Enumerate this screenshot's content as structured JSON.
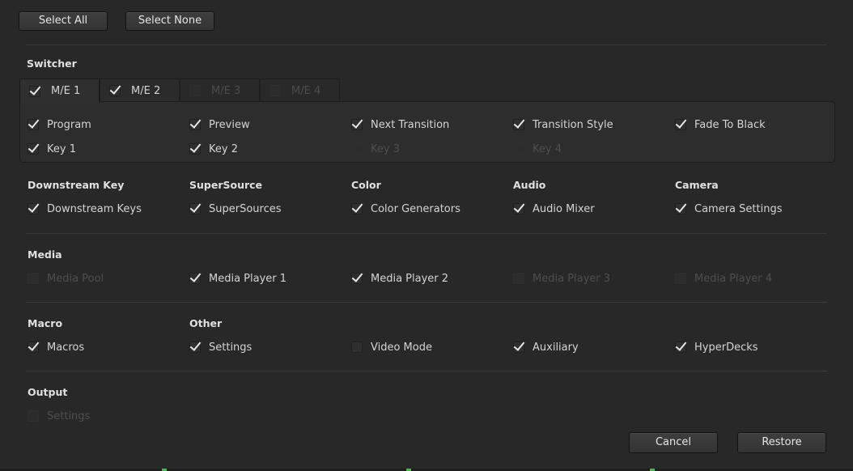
{
  "top_buttons": {
    "select_all": "Select All",
    "select_none": "Select None"
  },
  "switcher": {
    "title": "Switcher",
    "tabs": [
      {
        "label": "M/E 1",
        "checked": true,
        "enabled": true
      },
      {
        "label": "M/E 2",
        "checked": true,
        "enabled": true
      },
      {
        "label": "M/E 3",
        "checked": false,
        "enabled": false
      },
      {
        "label": "M/E 4",
        "checked": false,
        "enabled": false
      }
    ],
    "items": [
      {
        "label": "Program",
        "checked": true,
        "enabled": true
      },
      {
        "label": "Preview",
        "checked": true,
        "enabled": true
      },
      {
        "label": "Next Transition",
        "checked": true,
        "enabled": true
      },
      {
        "label": "Transition Style",
        "checked": true,
        "enabled": true
      },
      {
        "label": "Fade To Black",
        "checked": true,
        "enabled": true
      },
      {
        "label": "Key 1",
        "checked": true,
        "enabled": true
      },
      {
        "label": "Key 2",
        "checked": true,
        "enabled": true
      },
      {
        "label": "Key 3",
        "checked": false,
        "enabled": false
      },
      {
        "label": "Key 4",
        "checked": false,
        "enabled": false
      }
    ]
  },
  "row1": [
    {
      "title": "Downstream Key",
      "label": "Downstream Keys",
      "checked": true,
      "enabled": true
    },
    {
      "title": "SuperSource",
      "label": "SuperSources",
      "checked": true,
      "enabled": true
    },
    {
      "title": "Color",
      "label": "Color Generators",
      "checked": true,
      "enabled": true
    },
    {
      "title": "Audio",
      "label": "Audio Mixer",
      "checked": true,
      "enabled": true
    },
    {
      "title": "Camera",
      "label": "Camera Settings",
      "checked": true,
      "enabled": true
    }
  ],
  "media": {
    "title": "Media",
    "items": [
      {
        "label": "Media Pool",
        "checked": false,
        "enabled": false
      },
      {
        "label": "Media Player 1",
        "checked": true,
        "enabled": true
      },
      {
        "label": "Media Player 2",
        "checked": true,
        "enabled": true
      },
      {
        "label": "Media Player 3",
        "checked": false,
        "enabled": false
      },
      {
        "label": "Media Player 4",
        "checked": false,
        "enabled": false
      }
    ]
  },
  "macro_other": {
    "macro_title": "Macro",
    "other_title": "Other",
    "items": [
      {
        "label": "Macros",
        "checked": true,
        "enabled": true
      },
      {
        "label": "Settings",
        "checked": true,
        "enabled": true
      },
      {
        "label": "Video Mode",
        "checked": false,
        "enabled": true
      },
      {
        "label": "Auxiliary",
        "checked": true,
        "enabled": true
      },
      {
        "label": "HyperDecks",
        "checked": true,
        "enabled": true
      }
    ]
  },
  "output": {
    "title": "Output",
    "items": [
      {
        "label": "Settings",
        "checked": false,
        "enabled": false
      }
    ]
  },
  "footer": {
    "cancel": "Cancel",
    "restore": "Restore"
  }
}
